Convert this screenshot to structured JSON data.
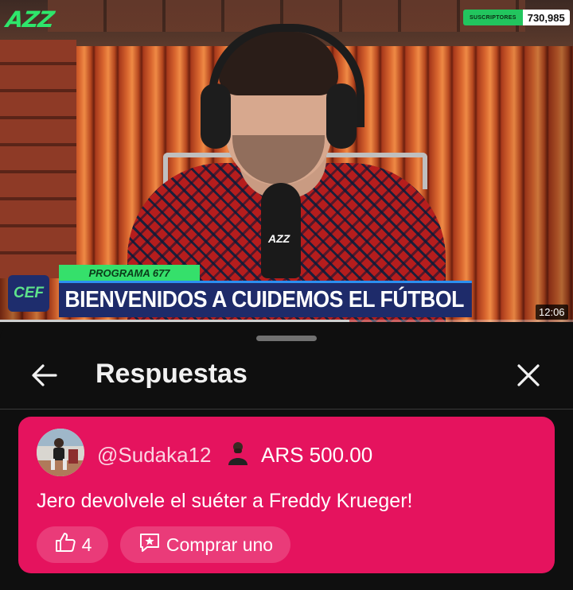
{
  "video": {
    "channel_logo": "AZZ",
    "subscribers_label": "SUSCRIPTORES",
    "subscribers_count": "730,985",
    "mic_logo": "AZZ",
    "program_tag": "PROGRAMA 677",
    "show_logo": "CEF",
    "lower_third_title": "BIENVENIDOS A CUIDEMOS EL FÚTBOL",
    "timestamp": "12:06",
    "progress_fraction": 0.61
  },
  "panel": {
    "title": "Respuestas",
    "back_icon": "arrow-left-icon",
    "close_icon": "close-icon"
  },
  "comment": {
    "username": "@Sudaka12",
    "amount": "ARS 500.00",
    "text": "Jero devolvele el suéter a Freddy Krueger!",
    "likes": "4",
    "buy_label": "Comprar uno",
    "card_color": "#e5135e"
  }
}
